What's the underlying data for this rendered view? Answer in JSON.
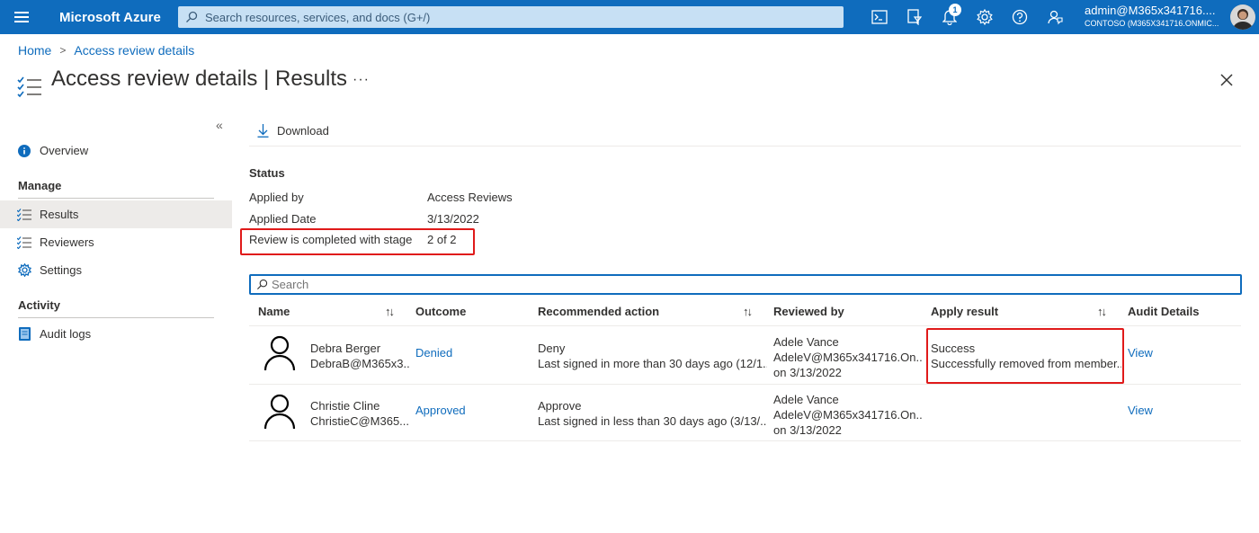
{
  "topbar": {
    "brand": "Microsoft Azure",
    "search_placeholder": "Search resources, services, and docs (G+/)",
    "notification_count": "1",
    "user": "admin@M365x341716....",
    "tenant": "CONTOSO (M365X341716.ONMIC..."
  },
  "breadcrumb": {
    "home": "Home",
    "current": "Access review details"
  },
  "page": {
    "title": "Access review details",
    "subtitle": "Results",
    "more": "···"
  },
  "sidebar": {
    "collapse": "«",
    "overview": "Overview",
    "manage_header": "Manage",
    "results": "Results",
    "reviewers": "Reviewers",
    "settings": "Settings",
    "activity_header": "Activity",
    "audit_logs": "Audit logs"
  },
  "toolbar": {
    "download": "Download"
  },
  "status": {
    "header": "Status",
    "applied_by_label": "Applied by",
    "applied_by_value": "Access Reviews",
    "applied_date_label": "Applied Date",
    "applied_date_value": "3/13/2022",
    "stage_label": "Review is completed with stage",
    "stage_value": "2 of 2"
  },
  "search": {
    "placeholder": "Search"
  },
  "table": {
    "headers": {
      "name": "Name",
      "outcome": "Outcome",
      "recommended": "Recommended action",
      "reviewed_by": "Reviewed by",
      "apply_result": "Apply result",
      "audit": "Audit Details"
    },
    "rows": [
      {
        "name": "Debra Berger",
        "email": "DebraB@M365x3...",
        "outcome": "Denied",
        "rec_action": "Deny",
        "rec_detail": "Last signed in more than 30 days ago (12/1...",
        "reviewer": "Adele Vance",
        "reviewer_email": "AdeleV@M365x341716.On...",
        "reviewed_on": "on 3/13/2022",
        "apply_status": "Success",
        "apply_detail": "Successfully removed from member...",
        "audit": "View"
      },
      {
        "name": "Christie Cline",
        "email": "ChristieC@M365...",
        "outcome": "Approved",
        "rec_action": "Approve",
        "rec_detail": "Last signed in less than 30 days ago (3/13/...",
        "reviewer": "Adele Vance",
        "reviewer_email": "AdeleV@M365x341716.On...",
        "reviewed_on": "on 3/13/2022",
        "apply_status": "",
        "apply_detail": "",
        "audit": "View"
      }
    ]
  }
}
